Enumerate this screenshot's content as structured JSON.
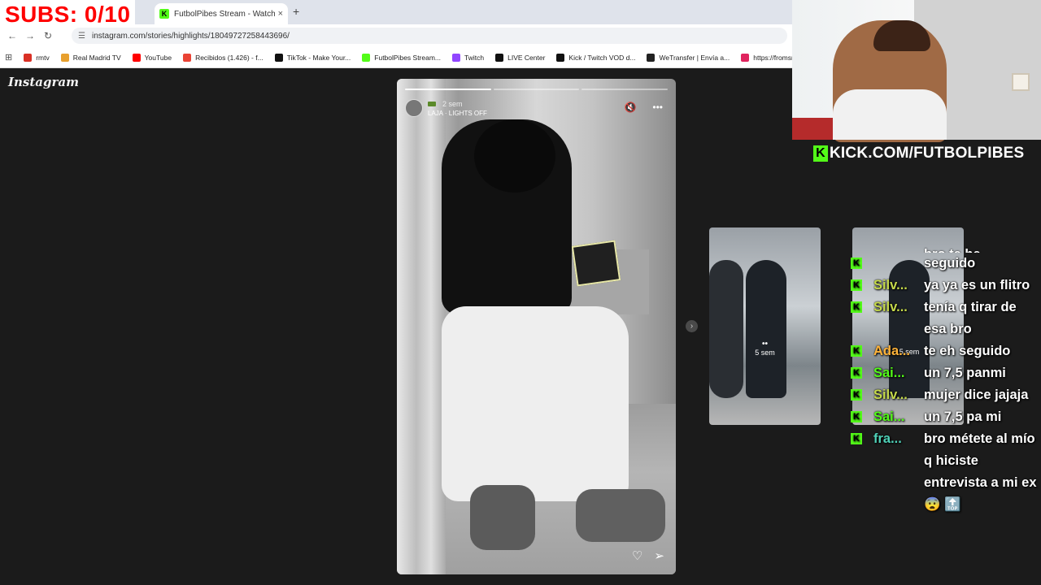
{
  "overlay": {
    "subs_goal": "SUBS: 0/10",
    "kick_url": "KICK.COM/FUTBOLPIBES",
    "kick_glyph": "K"
  },
  "browser": {
    "tab": {
      "title": "FutbolPibes Stream - Watch Liv",
      "close": "×",
      "favicon_letter": "K"
    },
    "new_tab": "+",
    "nav": {
      "back": "←",
      "forward": "→",
      "reload": "↻"
    },
    "url": "instagram.com/stories/highlights/18049727258443696/",
    "apps_icon": "⊞",
    "bookmarks": [
      {
        "label": "rmtv",
        "color": "#d93025"
      },
      {
        "label": "Real Madrid TV",
        "color": "#e8a02e"
      },
      {
        "label": "YouTube",
        "color": "#ff0000"
      },
      {
        "label": "Recibidos (1.426) - f...",
        "color": "#ea4335"
      },
      {
        "label": "TikTok - Make Your...",
        "color": "#111111"
      },
      {
        "label": "FutbolPibes Stream...",
        "color": "#53fc18"
      },
      {
        "label": "Twitch",
        "color": "#9146ff"
      },
      {
        "label": "LIVE Center",
        "color": "#111111"
      },
      {
        "label": "Kick / Twitch VOD d...",
        "color": "#111111"
      },
      {
        "label": "WeTransfer | Envía a...",
        "color": "#222222"
      },
      {
        "label": "https://fromsmash.c...",
        "color": "#e0245e"
      }
    ]
  },
  "instagram": {
    "logo": "Instagram",
    "story": {
      "time": "2 sem",
      "song": "LAJA · LIGHTS OFF",
      "mute_icon": "🔇",
      "more_icon": "•••",
      "like_icon": "♡",
      "share_icon": "➢",
      "segments": 3
    },
    "next_arrow": "›",
    "thumbs": [
      {
        "dots": "••",
        "label": "5 sem"
      },
      {
        "dots": "",
        "label": "5 sem"
      }
    ]
  },
  "chat": {
    "partial_top": "bro te he",
    "messages": [
      {
        "user": "",
        "text": "seguido",
        "color": "u-green"
      },
      {
        "user": "Silv...",
        "text": "ya ya es un flitro",
        "color": "u-yellow"
      },
      {
        "user": "Silv...",
        "text": "tenía q tirar de esa bro",
        "color": "u-yellow"
      },
      {
        "user": "Ada...",
        "text": "te eh seguido",
        "color": "u-orange"
      },
      {
        "user": "Sai...",
        "text": "un 7,5 panmi",
        "color": "u-green"
      },
      {
        "user": "Silv...",
        "text": "mujer dice jajaja",
        "color": "u-yellow"
      },
      {
        "user": "Sai...",
        "text": "un 7,5 pa mi",
        "color": "u-green"
      },
      {
        "user": "fra...",
        "text": "bro métete al mío q hiciste entrevista a mi ex 😨 🔝",
        "color": "u-teal"
      }
    ]
  }
}
